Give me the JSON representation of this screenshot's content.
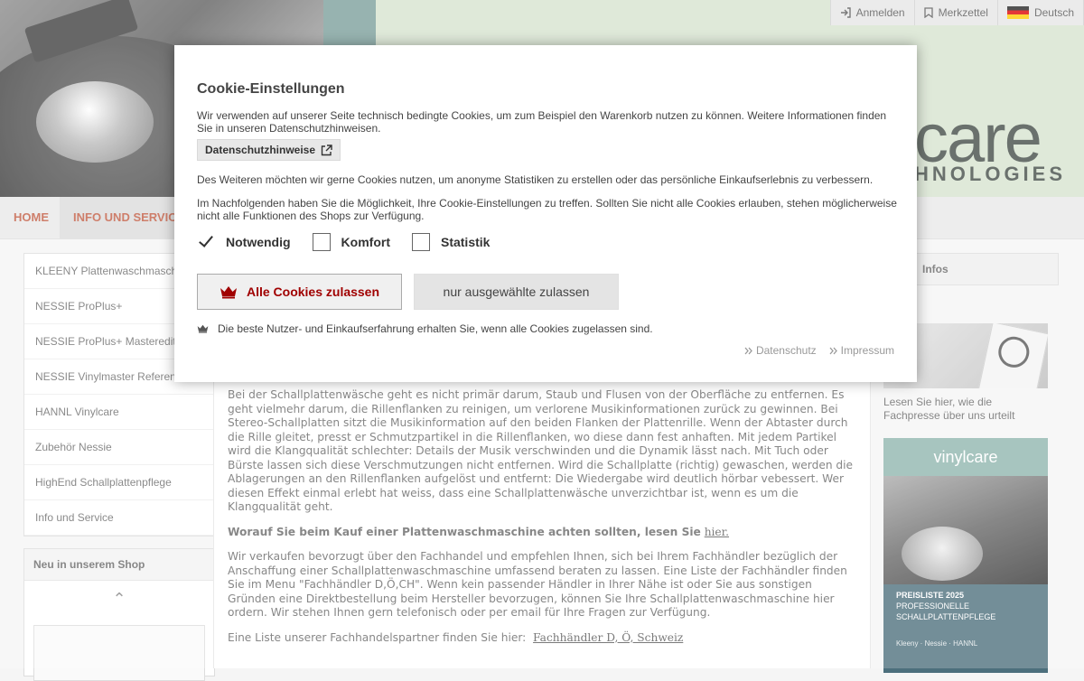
{
  "topbar": {
    "login": "Anmelden",
    "wishlist": "Merkzettel",
    "language": "Deutsch"
  },
  "logo": {
    "line1": "care",
    "line2": "HNOLOGIES"
  },
  "nav": {
    "home": "HOME",
    "info": "INFO UND SERVICE"
  },
  "sidebar": {
    "items": [
      {
        "label": "KLEENY Plattenwaschmaschine"
      },
      {
        "label": "NESSIE ProPlus+"
      },
      {
        "label": "NESSIE ProPlus+ Masteredition"
      },
      {
        "label": "NESSIE Vinylmaster Reference"
      },
      {
        "label": "HANNL Vinylcare"
      },
      {
        "label": "Zubehör Nessie"
      },
      {
        "label": "HighEnd Schallplattenpflege"
      },
      {
        "label": "Info und Service"
      }
    ]
  },
  "newbox": {
    "title": "Neu in unserem Shop",
    "arrow": "⌃"
  },
  "content": {
    "p1": "Bei der Schallplattenwäsche geht es nicht primär darum, Staub und Flusen von der Oberfläche zu entfernen. Es geht vielmehr darum, die Rillenflanken zu reinigen, um verlorene Musikinformationen zurück zu gewinnen. Bei Stereo-Schallplatten sitzt die Musikinformation auf den beiden Flanken der Plattenrille. Wenn der Abtaster durch die Rille gleitet,  presst er Schmutzpartikel in die Rillenflanken, wo diese dann fest anhaften. Mit jedem Partikel wird die Klangqualität schlechter: Details der Musik verschwinden und die Dynamik lässt nach. Mit Tuch oder Bürste lassen sich diese Verschmutzungen nicht entfernen. Wird die Schallplatte (richtig) gewaschen, werden die Ablagerungen an den Rillenflanken aufgelöst und entfernt: Die Wiedergabe wird deutlich hörbar vebessert. Wer diesen Effekt einmal erlebt hat weiss, dass eine Schallplattenwäsche unverzichtbar ist, wenn es um die Klangqualität geht.",
    "p2_lead": "Worauf Sie beim Kauf einer Plattenwaschmaschine achten sollten, lesen Sie",
    "p2_link": "hier.",
    "p3": "Wir verkaufen bevorzugt über den Fachhandel und empfehlen Ihnen, sich bei Ihrem Fachhändler bezüglich der Anschaffung einer Schallplattenwaschmaschine umfassend beraten zu lassen. Eine Liste der Fachhändler finden Sie im Menu \"Fachhändler D,Ö,CH\". Wenn kein passender Händler in Ihrer Nähe ist oder Sie aus sonstigen Gründen eine Direktbestellung beim Hersteller bevorzugen, können Sie Ihre Schallplattenwaschmaschine hier ordern. Wir stehen Ihnen gern telefonisch oder per email für Ihre Fragen zur Verfügung.",
    "p4_text": "Eine Liste unserer Fachhandelspartner finden Sie hier:",
    "p4_link": "Fachhändler D, Ö, Schweiz"
  },
  "rightcol": {
    "infos_title": "Infos",
    "press_text": "Lesen Sie hier, wie die Fachpresse über uns urteilt",
    "price_logo": "vinylcare",
    "price_title": "PREISLISTE 2025",
    "price_sub1": "PROFESSIONELLE",
    "price_sub2": "SCHALLPLATTENPFLEGE",
    "price_brands": "Kleeny · Nessie · HANNL"
  },
  "cookie": {
    "title": "Cookie-Einstellungen",
    "p1": "Wir verwenden auf unserer Seite technisch bedingte Cookies, um zum Beispiel den Warenkorb nutzen zu können. Weitere Informationen finden Sie in unseren Datenschutzhinweisen.",
    "privacy_button": "Datenschutzhinweise",
    "p2": "Des Weiteren möchten wir gerne Cookies nutzen, um anonyme Statistiken zu erstellen oder das persönliche Einkaufserlebnis zu verbessern.",
    "p3": "Im Nachfolgenden haben Sie die Möglichkeit, Ihre Cookie-Einstellungen zu treffen. Sollten Sie nicht alle Cookies erlauben, stehen möglicherweise nicht alle Funktionen des Shops zur Verfügung.",
    "checks": [
      {
        "label": "Notwendig",
        "checked": true
      },
      {
        "label": "Komfort",
        "checked": false
      },
      {
        "label": "Statistik",
        "checked": false
      }
    ],
    "btn_all": "Alle Cookies zulassen",
    "btn_selected": "nur ausgewählte zulassen",
    "hint": "Die beste Nutzer- und Einkaufserfahrung erhalten Sie, wenn alle Cookies zugelassen sind.",
    "link_privacy": "Datenschutz",
    "link_imprint": "Impressum"
  },
  "colors": {
    "accent": "#a00000",
    "nav_text": "#c15a40",
    "banner": "#d6e3cf"
  }
}
